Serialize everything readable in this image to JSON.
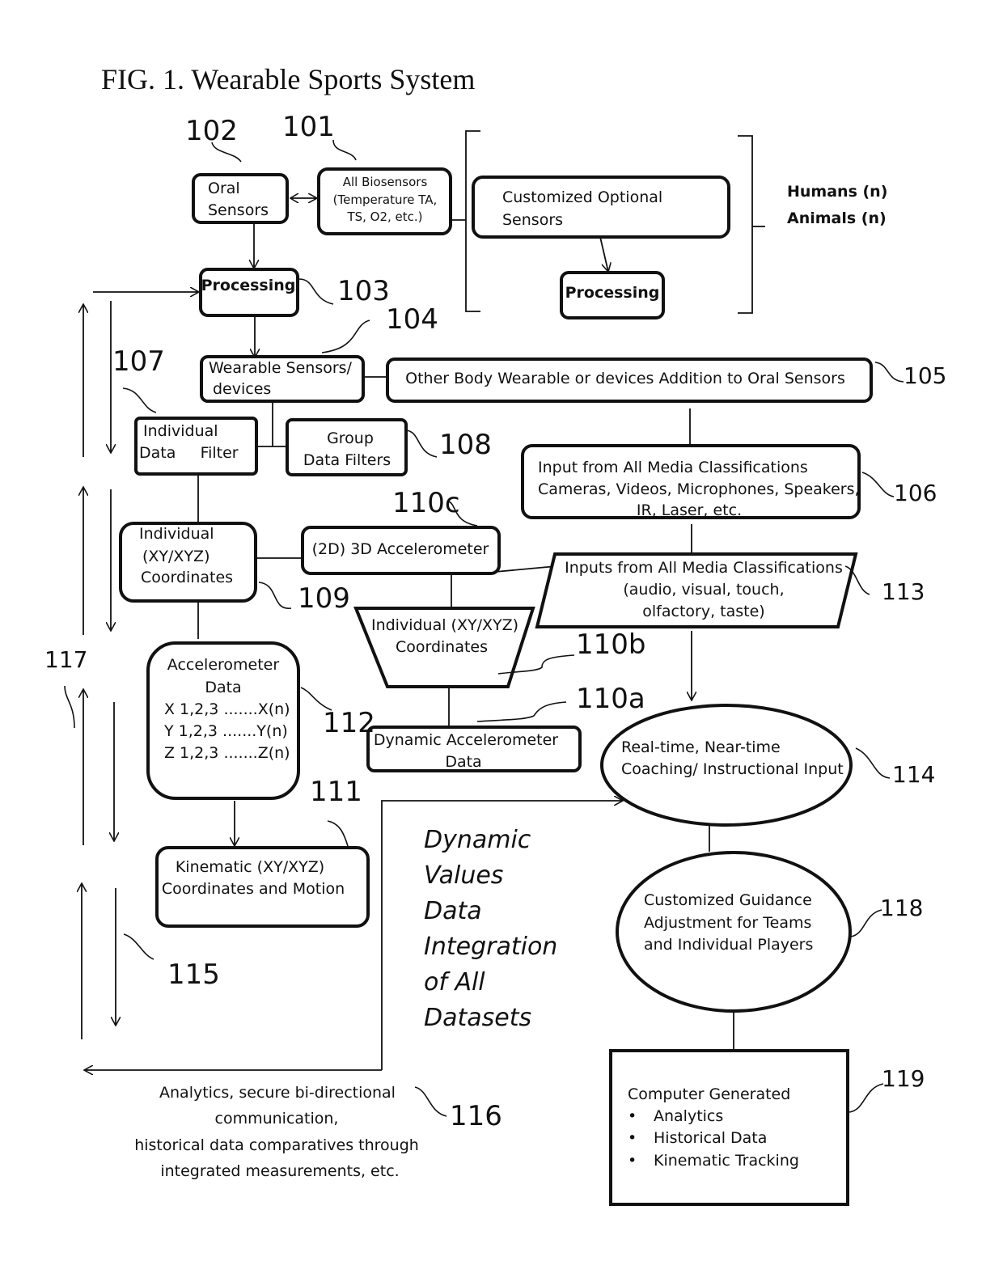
{
  "figure": {
    "title": "FIG. 1. Wearable Sports System"
  },
  "nodes": {
    "oral_sensors": {
      "ref": "102",
      "lines": [
        "Oral",
        "Sensors"
      ]
    },
    "all_biosensors": {
      "ref": "101",
      "lines": [
        "All  Biosensors",
        "(Temperature TA,",
        "TS, O2, etc.)"
      ]
    },
    "customized_optional_sensors": {
      "lines": [
        "Customized  Optional",
        "Sensors"
      ]
    },
    "processing_optional": {
      "lines": [
        "Processing"
      ]
    },
    "subjects": {
      "lines": [
        "Humans (n)",
        "Animals (n)"
      ]
    },
    "processing": {
      "ref": "103",
      "lines": [
        "Processing"
      ]
    },
    "wearable_sensors": {
      "ref": "104",
      "lines": [
        "Wearable Sensors/",
        "devices"
      ]
    },
    "other_body_wearable": {
      "ref": "105",
      "lines": [
        "Other Body Wearable or devices Addition to Oral Sensors"
      ]
    },
    "input_all_media": {
      "ref": "106",
      "lines": [
        "Input from All Media Classifications",
        "Cameras, Videos, Microphones, Speakers,",
        "IR, Laser, etc."
      ]
    },
    "individual_data_filter": {
      "ref": "107",
      "lines": [
        "Individual",
        "Data     Filter"
      ]
    },
    "group_data_filters": {
      "ref": "108",
      "lines": [
        "Group",
        "Data Filters"
      ]
    },
    "individual_coordinates": {
      "ref": "109",
      "lines": [
        "Individual",
        "(XY/XYZ)",
        "Coordinates"
      ]
    },
    "accelerometer_3d": {
      "ref": "110c",
      "lines": [
        "(2D) 3D Accelerometer"
      ]
    },
    "individual_coordinates_trap": {
      "ref": "110b",
      "lines": [
        "Individual (XY/XYZ)",
        "Coordinates"
      ]
    },
    "dynamic_accelerometer_data": {
      "ref": "110a",
      "lines": [
        "Dynamic Accelerometer",
        "Data"
      ]
    },
    "kinematic": {
      "ref": "111",
      "lines": [
        "Kinematic (XY/XYZ)",
        "Coordinates and Motion"
      ]
    },
    "accelerometer_data": {
      "ref": "112",
      "lines": [
        "Accelerometer",
        "Data",
        "X 1,2,3 .......X(n)",
        "Y 1,2,3 .......Y(n)",
        "Z 1,2,3 .......Z(n)"
      ]
    },
    "inputs_all_media": {
      "ref": "113",
      "lines": [
        "Inputs from All Media Classifications",
        "(audio, visual, touch,",
        "olfactory, taste)"
      ]
    },
    "coaching_input": {
      "ref": "114",
      "lines": [
        "Real-time, Near-time",
        "Coaching/ Instructional Input"
      ]
    },
    "feedback_arrows": {
      "ref": "115"
    },
    "analytics_comm": {
      "ref": "116",
      "lines": [
        "Analytics, secure bi-directional",
        "communication,",
        "historical data comparatives through",
        "integrated measurements, etc."
      ]
    },
    "side_arrows": {
      "ref": "117"
    },
    "customized_guidance": {
      "ref": "118",
      "lines": [
        "Customized Guidance",
        "Adjustment for Teams",
        "and Individual Players"
      ]
    },
    "computer_generated": {
      "ref": "119",
      "heading": "Computer Generated",
      "bullets": [
        "Analytics",
        "Historical Data",
        "Kinematic Tracking"
      ]
    },
    "integration_label": {
      "lines": [
        "Dynamic",
        "Values",
        "Data",
        "Integration",
        "of All",
        "Datasets"
      ]
    }
  }
}
